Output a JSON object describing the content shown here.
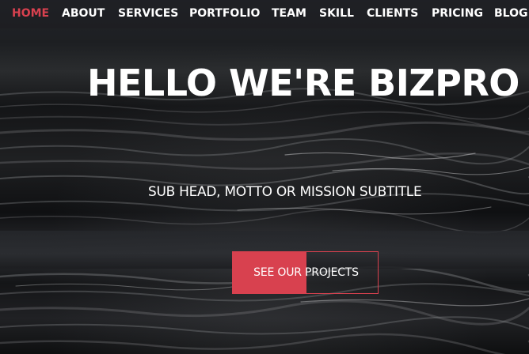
{
  "nav": {
    "items": [
      {
        "label": "HOME",
        "active": true
      },
      {
        "label": "ABOUT",
        "active": false
      },
      {
        "label": "SERVICES",
        "active": false
      },
      {
        "label": "PORTFOLIO",
        "active": false
      },
      {
        "label": "TEAM",
        "active": false
      },
      {
        "label": "SKILL",
        "active": false
      },
      {
        "label": "CLIENTS",
        "active": false
      },
      {
        "label": "PRICING",
        "active": false
      },
      {
        "label": "BLOG",
        "active": false
      }
    ]
  },
  "hero": {
    "headline": "HELLO WE'RE BIZPRO",
    "subtitle": "SUB HEAD, MOTTO OR MISSION SUBTITLE",
    "cta_label": "SEE OUR PROJECTS"
  },
  "colors": {
    "accent": "#d8414f",
    "text": "#ffffff",
    "background": "#1a1c1f"
  }
}
